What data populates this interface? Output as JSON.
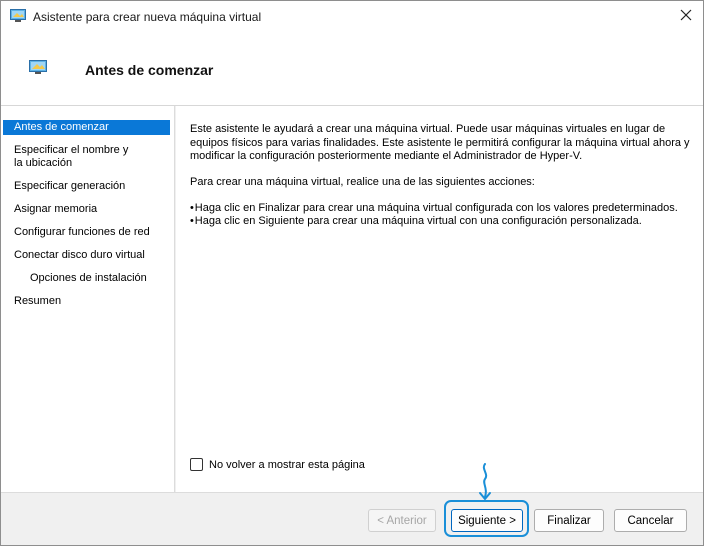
{
  "window": {
    "title": "Asistente para crear nueva máquina virtual",
    "close_icon": "close-icon"
  },
  "header": {
    "title": "Antes de comenzar",
    "icon": "virtual-machine-icon"
  },
  "sidebar": {
    "items": [
      {
        "label": "Antes de comenzar",
        "active": true
      },
      {
        "label": "Especificar el nombre y la ubicación"
      },
      {
        "label": "Especificar generación"
      },
      {
        "label": "Asignar memoria"
      },
      {
        "label": "Configurar funciones de red"
      },
      {
        "label": "Conectar disco duro virtual"
      },
      {
        "label": "Opciones de instalación",
        "sub": true
      },
      {
        "label": "Resumen"
      }
    ]
  },
  "content": {
    "paragraph1": "Este asistente le ayudará a crear una máquina virtual. Puede usar máquinas virtuales en lugar de equipos físicos para varias finalidades. Este asistente le permitirá configurar la máquina virtual ahora y modificar la configuración posteriormente mediante el Administrador de Hyper-V.",
    "paragraph2": "Para crear una máquina virtual, realice una de las siguientes acciones:",
    "bullets": [
      "Haga clic en Finalizar para crear una máquina virtual configurada con los valores predeterminados.",
      "Haga clic en Siguiente para crear una máquina virtual con una configuración personalizada."
    ],
    "checkbox_label": "No volver a mostrar esta página",
    "checkbox_checked": false
  },
  "footer": {
    "previous_label": "< Anterior",
    "next_label": "Siguiente >",
    "finish_label": "Finalizar",
    "cancel_label": "Cancelar"
  },
  "colors": {
    "accent": "#0a78d7",
    "highlight": "#1a8fd8"
  }
}
